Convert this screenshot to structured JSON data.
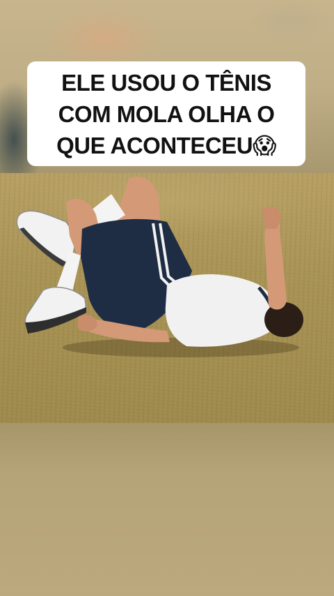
{
  "caption": {
    "text": "ELE USOU O TÊNIS COM MOLA OLHA O QUE ACONTECEU😱"
  },
  "scene": {
    "description_colors": {
      "grass": "#a89355",
      "shorts": "#1f2d44",
      "shirt": "#f1f1f1",
      "socks": "#f5f5f5",
      "skin": "#d49a78",
      "hair": "#2a1e17"
    }
  }
}
